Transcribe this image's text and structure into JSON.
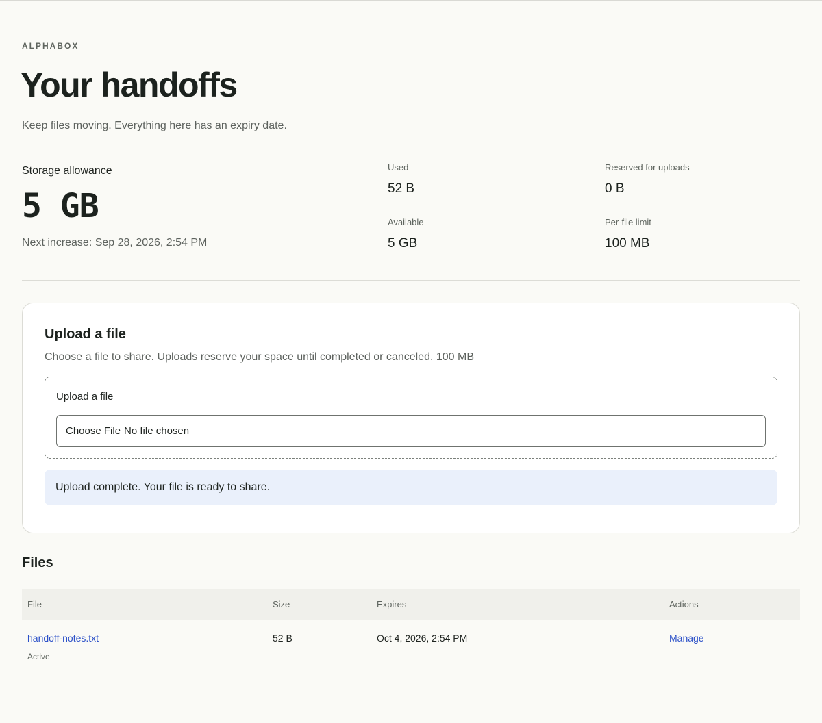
{
  "header": {
    "brand": "ALPHABOX",
    "title": "Your handoffs",
    "subtitle": "Keep files moving. Everything here has an expiry date."
  },
  "storage": {
    "label": "Storage allowance",
    "value": "5 GB",
    "next_increase": "Next increase: Sep 28, 2026, 2:54 PM",
    "stats": {
      "used": {
        "label": "Used",
        "value": "52 B"
      },
      "reserved": {
        "label": "Reserved for uploads",
        "value": "0 B"
      },
      "available": {
        "label": "Available",
        "value": "5 GB"
      },
      "limit": {
        "label": "Per-file limit",
        "value": "100 MB"
      }
    }
  },
  "upload": {
    "title": "Upload a file",
    "description": "Choose a file to share. Uploads reserve your space until completed or canceled. 100 MB",
    "dropzone_label": "Upload a file",
    "choose_button": "Choose File",
    "no_file": "No file chosen",
    "notice": "Upload complete. Your file is ready to share."
  },
  "files": {
    "title": "Files",
    "columns": {
      "file": "File",
      "size": "Size",
      "expires": "Expires",
      "actions": "Actions"
    },
    "rows": [
      {
        "name": "handoff-notes.txt",
        "status": "Active",
        "size": "52 B",
        "expires": "Oct 4, 2026, 2:54 PM",
        "action": "Manage"
      }
    ]
  }
}
